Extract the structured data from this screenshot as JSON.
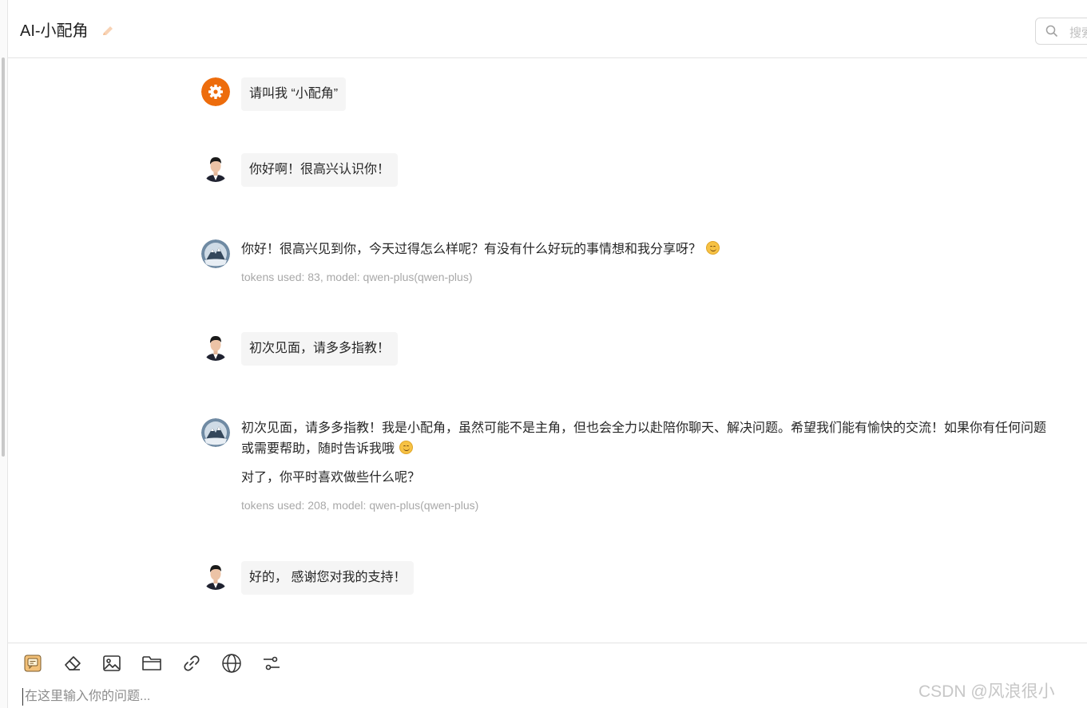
{
  "header": {
    "title": "AI-小配角",
    "search_placeholder": "搜索"
  },
  "messages": [
    {
      "role": "system",
      "text": "请叫我 “小配角”"
    },
    {
      "role": "user",
      "text": "你好啊！很高兴认识你！"
    },
    {
      "role": "assistant",
      "paragraphs": [
        "你好！很高兴见到你，今天过得怎么样呢？有没有什么好玩的事情想和我分享呀？"
      ],
      "meta": "tokens used: 83, model: qwen-plus(qwen-plus)"
    },
    {
      "role": "user",
      "text": "初次见面，请多多指教！"
    },
    {
      "role": "assistant",
      "paragraphs": [
        "初次见面，请多多指教！我是小配角，虽然可能不是主角，但也会全力以赴陪你聊天、解决问题。希望我们能有愉快的交流！如果你有任何问题或需要帮助，随时告诉我哦",
        "对了，你平时喜欢做些什么呢？"
      ],
      "meta": "tokens used: 208, model: qwen-plus(qwen-plus)"
    },
    {
      "role": "user",
      "text": "好的，  感谢您对我的支持！"
    }
  ],
  "toolbar": {
    "icons": [
      "chat-mode-icon",
      "eraser-icon",
      "image-icon",
      "folder-icon",
      "link-icon",
      "globe-icon",
      "settings-sliders-icon"
    ]
  },
  "input": {
    "placeholder": "在这里输入你的问题..."
  },
  "watermark": "CSDN @风浪很小",
  "colors": {
    "system_avatar": "#ed6c0c",
    "bubble_bg": "#f5f5f5",
    "meta_text": "#a8a8a8"
  }
}
